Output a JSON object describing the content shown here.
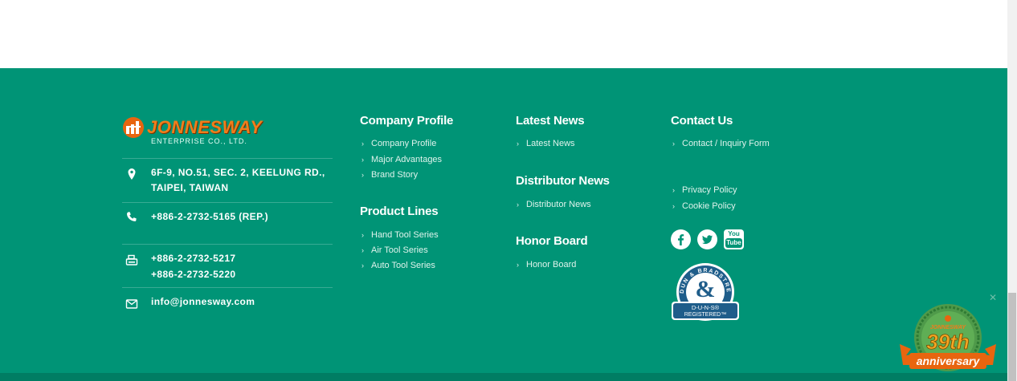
{
  "brand": {
    "name": "JONNESWAY",
    "subtitle": "ENTERPRISE CO., LTD."
  },
  "contact": {
    "address_line1": "6F-9, NO.51, SEC. 2, KEELUNG RD.,",
    "address_line2": "TAIPEI, TAIWAN",
    "phone": "+886-2-2732-5165 (REP.)",
    "fax1": "+886-2-2732-5217",
    "fax2": "+886-2-2732-5220",
    "email": "info@jonnesway.com"
  },
  "columns": {
    "company_profile": {
      "title": "Company Profile",
      "links": [
        "Company Profile",
        "Major Advantages",
        "Brand Story"
      ]
    },
    "product_lines": {
      "title": "Product Lines",
      "links": [
        "Hand Tool Series",
        "Air Tool Series",
        "Auto Tool Series"
      ]
    },
    "latest_news": {
      "title": "Latest News",
      "links": [
        "Latest News"
      ]
    },
    "distributor_news": {
      "title": "Distributor News",
      "links": [
        "Distributor News"
      ]
    },
    "honor_board": {
      "title": "Honor Board",
      "links": [
        "Honor Board"
      ]
    },
    "contact_us": {
      "title": "Contact Us",
      "links": [
        "Contact / Inquiry Form"
      ]
    },
    "policies": {
      "links": [
        "Privacy Policy",
        "Cookie Policy"
      ]
    }
  },
  "social": {
    "icons": [
      "facebook-icon",
      "twitter-icon",
      "youtube-icon"
    ],
    "youtube_top": "You",
    "youtube_bottom": "Tube"
  },
  "duns_badge": {
    "arc_text": "DUN & BRADSTREET",
    "line1": "D-U-N-S®",
    "line2": "REGISTERED™"
  },
  "anniversary": {
    "brand": "JONNESWAY",
    "number": "39th",
    "label": "anniversary"
  },
  "colors": {
    "footer_bg": "#009476",
    "footer_bottom": "#007d63",
    "brand_orange": "#f07d1b",
    "duns_blue": "#1f5d8a"
  }
}
